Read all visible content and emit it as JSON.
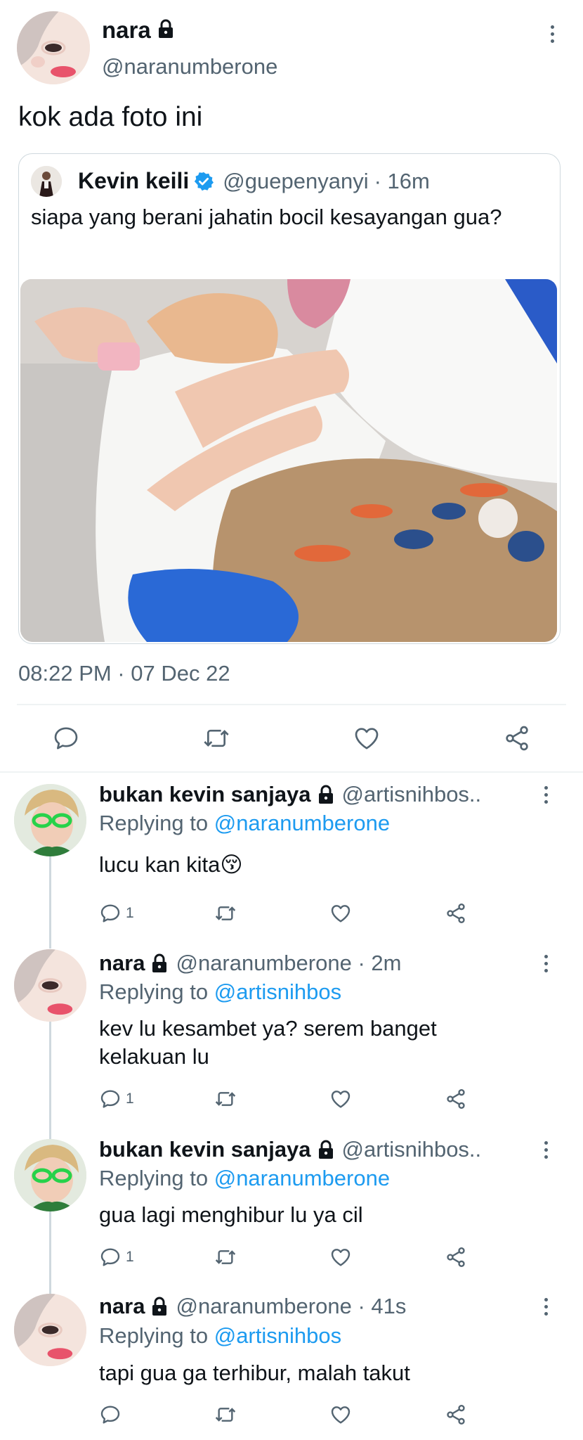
{
  "main_tweet": {
    "display_name": "nara",
    "handle": "@naranumberone",
    "text": "kok ada foto ini",
    "timestamp": "08:22 PM · 07 Dec 22"
  },
  "quoted_tweet": {
    "display_name": "Kevin keili",
    "handle": "@guepenyanyi",
    "time": "· 16m",
    "text": "siapa yang berani jahatin bocil kesayangan gua?"
  },
  "replies": [
    {
      "display_name": "bukan kevin sanjaya",
      "handle": "@artisnihbos..",
      "replying_label": "Replying to",
      "replying_handle": "@naranumberone",
      "text": "lucu kan kita😚",
      "reply_count": "1"
    },
    {
      "display_name": "nara",
      "handle": "@naranumberone · 2m",
      "replying_label": "Replying to",
      "replying_handle": "@artisnihbos",
      "text": "kev lu kesambet ya? serem banget kelakuan lu",
      "reply_count": "1"
    },
    {
      "display_name": "bukan kevin sanjaya",
      "handle": "@artisnihbos..",
      "replying_label": "Replying to",
      "replying_handle": "@naranumberone",
      "text": "gua lagi menghibur lu ya cil",
      "reply_count": "1"
    },
    {
      "display_name": "nara",
      "handle": "@naranumberone · 41s",
      "replying_label": "Replying to",
      "replying_handle": "@artisnihbos",
      "text": "tapi gua ga terhibur, malah takut",
      "reply_count": ""
    }
  ],
  "colors": {
    "accent": "#1d9bf0",
    "text": "#0f1419",
    "muted": "#536471",
    "divider": "#eff3f4"
  },
  "icons": [
    "lock-icon",
    "verified-icon",
    "reply-icon",
    "retweet-icon",
    "like-icon",
    "share-icon",
    "more-icon"
  ]
}
